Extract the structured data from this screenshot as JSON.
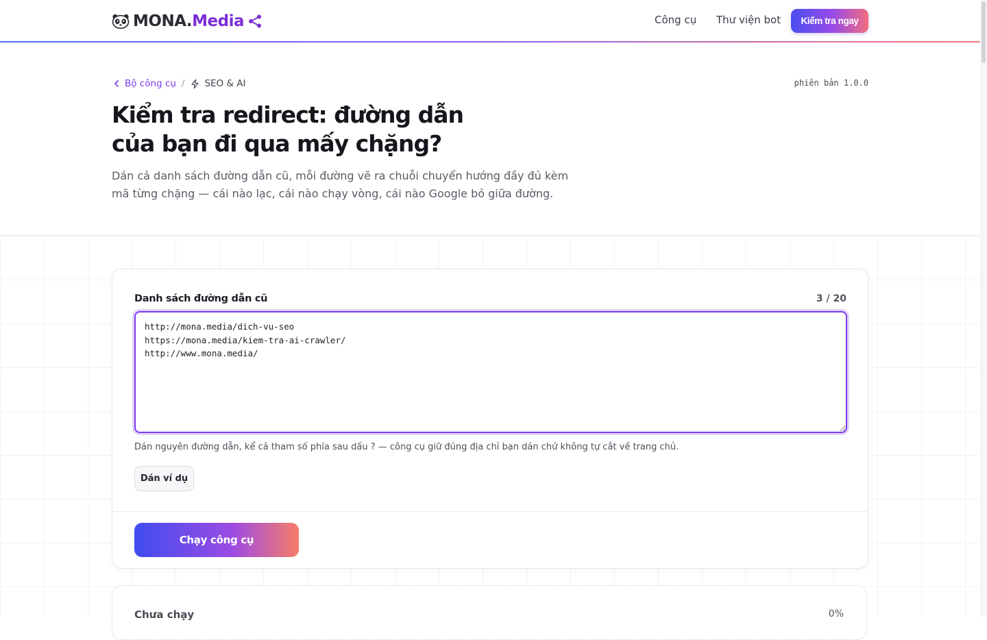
{
  "header": {
    "logo": {
      "brand": "MONA.",
      "highlight": "Media"
    },
    "nav": [
      {
        "label": "Công cụ"
      },
      {
        "label": "Thư viện bot"
      }
    ],
    "cta_label": "Kiểm tra ngay",
    "accent_gradient": [
      "#4b6ef5",
      "#8b5cf6",
      "#f47a7a"
    ]
  },
  "hero": {
    "breadcrumb": {
      "back_label": "Bộ công cụ",
      "separator": "/",
      "category": "SEO & AI"
    },
    "version": "phiên bản 1.0.0",
    "title": "Kiểm tra redirect: đường dẫn của bạn đi qua mấy chặng?",
    "description": "Dán cả danh sách đường dẫn cũ, mỗi đường vẽ ra chuỗi chuyển hướng đầy đủ kèm mã từng chặng — cái nào lạc, cái nào chạy vòng, cái nào Google bỏ giữa đường."
  },
  "form": {
    "label": "Danh sách đường dẫn cũ",
    "count": "3 / 20",
    "urls": "http://mona.media/dich-vu-seo\nhttps://mona.media/kiem-tra-ai-crawler/\nhttp://www.mona.media/",
    "hint": "Dán nguyên đường dẫn, kể cả tham số phía sau dấu ? — công cụ giữ đúng địa chỉ bạn dán chứ không tự cắt về trang chủ.",
    "example_button": "Dán ví dụ",
    "run_button": "Chạy công cụ",
    "focus_color": "#7c3aed"
  },
  "status": {
    "label": "Chưa chạy",
    "progress": "0%"
  },
  "icons": {
    "logo": "panda-icon",
    "share": "share-icon",
    "back": "chevron-left-icon",
    "category": "bolt-icon"
  }
}
